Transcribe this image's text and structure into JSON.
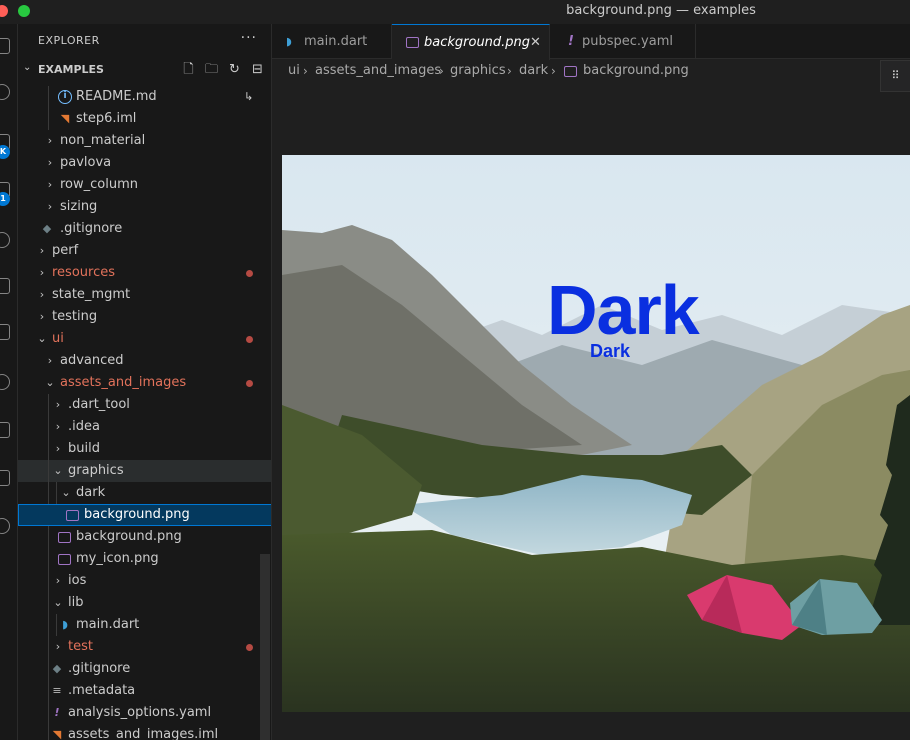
{
  "window": {
    "title": "background.png — examples"
  },
  "activity_bar": {
    "badges": [
      "K",
      "1"
    ]
  },
  "sidebar": {
    "header": "EXPLORER",
    "more": "···",
    "section": {
      "title": "EXAMPLES"
    },
    "tree": [
      {
        "label": "README.md",
        "type": "file",
        "icon": "info"
      },
      {
        "label": "step6.iml",
        "type": "file",
        "icon": "rss"
      },
      {
        "label": "non_material",
        "type": "folder"
      },
      {
        "label": "pavlova",
        "type": "folder"
      },
      {
        "label": "row_column",
        "type": "folder"
      },
      {
        "label": "sizing",
        "type": "folder"
      },
      {
        "label": ".gitignore",
        "type": "file",
        "icon": "git"
      },
      {
        "label": "perf",
        "type": "folder"
      },
      {
        "label": "resources",
        "type": "folder",
        "modified": true
      },
      {
        "label": "state_mgmt",
        "type": "folder"
      },
      {
        "label": "testing",
        "type": "folder"
      },
      {
        "label": "ui",
        "type": "folder",
        "expanded": true,
        "modified": true
      },
      {
        "label": "advanced",
        "type": "folder"
      },
      {
        "label": "assets_and_images",
        "type": "folder",
        "expanded": true,
        "modified": true
      },
      {
        "label": ".dart_tool",
        "type": "folder"
      },
      {
        "label": ".idea",
        "type": "folder"
      },
      {
        "label": "build",
        "type": "folder"
      },
      {
        "label": "graphics",
        "type": "folder",
        "expanded": true
      },
      {
        "label": "dark",
        "type": "folder",
        "expanded": true
      },
      {
        "label": "background.png",
        "type": "file",
        "icon": "image",
        "selected": true
      },
      {
        "label": "background.png",
        "type": "file",
        "icon": "image"
      },
      {
        "label": "my_icon.png",
        "type": "file",
        "icon": "image"
      },
      {
        "label": "ios",
        "type": "folder"
      },
      {
        "label": "lib",
        "type": "folder",
        "expanded": true
      },
      {
        "label": "main.dart",
        "type": "file",
        "icon": "dart"
      },
      {
        "label": "test",
        "type": "folder",
        "modified": true
      },
      {
        "label": ".gitignore",
        "type": "file",
        "icon": "git"
      },
      {
        "label": ".metadata",
        "type": "file",
        "icon": "lines"
      },
      {
        "label": "analysis_options.yaml",
        "type": "file",
        "icon": "bang"
      },
      {
        "label": "assets_and_images.iml",
        "type": "file",
        "icon": "rss"
      }
    ]
  },
  "tabs": [
    {
      "label": "main.dart",
      "icon": "dart",
      "active": false
    },
    {
      "label": "background.png",
      "icon": "image",
      "active": true
    },
    {
      "label": "pubspec.yaml",
      "icon": "bang",
      "active": false
    }
  ],
  "breadcrumb": [
    "ui",
    "assets_and_images",
    "graphics",
    "dark",
    "background.png"
  ],
  "preview": {
    "overlay_title": "Dark",
    "overlay_subtitle": "Dark"
  },
  "colors": {
    "accent": "#0078d4",
    "modified": "#e2725b",
    "overlay_text": "#0a2fe0"
  }
}
